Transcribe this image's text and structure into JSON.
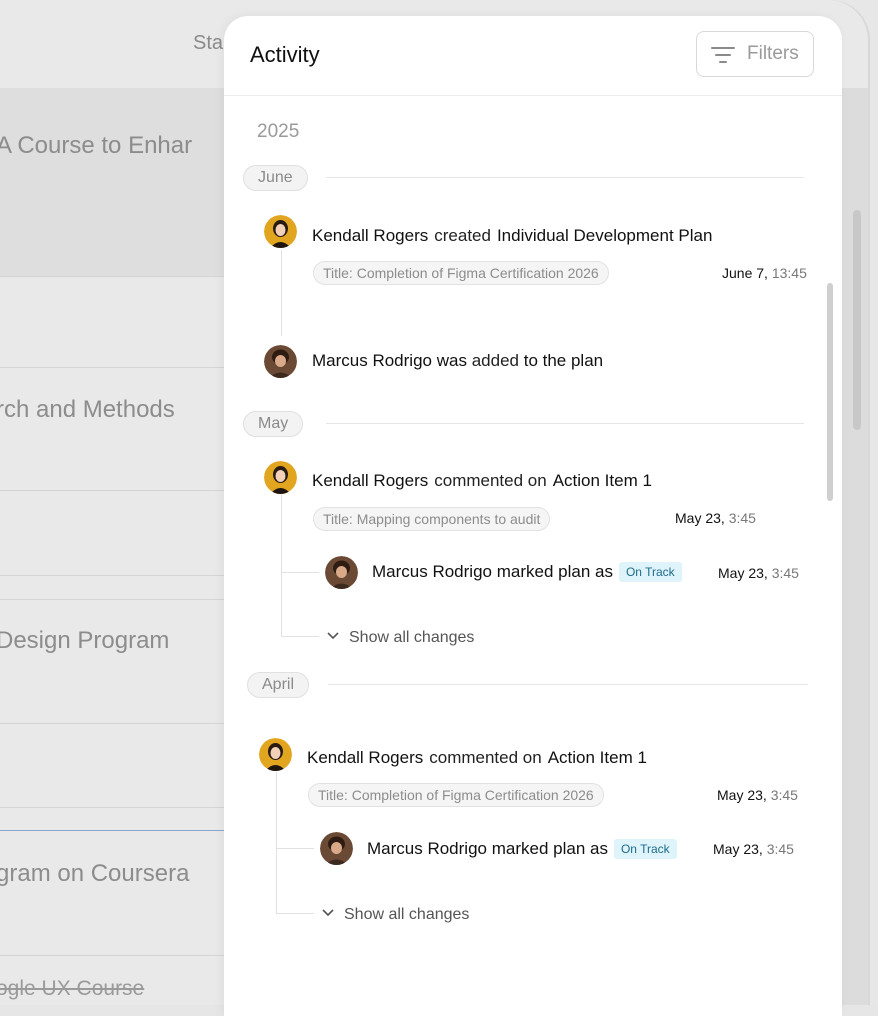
{
  "background": {
    "header_cell": "Sta",
    "rows": [
      {
        "text": "A Course to Enhar",
        "highlight": true
      },
      {
        "text": ""
      },
      {
        "text": "rch and Methods"
      },
      {
        "text": ""
      },
      {
        "text": "Design Program"
      },
      {
        "text": ""
      },
      {
        "text": "gram on Coursera"
      },
      {
        "text": "ogle UX Course",
        "strikethrough": true
      }
    ]
  },
  "panel": {
    "title": "Activity",
    "filters_label": "Filters",
    "filters_icon": "filter-lines-icon",
    "year": "2025",
    "groups": [
      {
        "month": "June",
        "entries": [
          {
            "actor": "Kendall Rogers",
            "verb": "created",
            "object": "Individual Development Plan",
            "chip": "Title: Completion of Figma Certification 2026",
            "date": "June 7,",
            "time": "13:45"
          },
          {
            "actor": "Marcus Rodrigo",
            "text_was": "was",
            "text_added": "added",
            "text_to": "to the plan"
          }
        ]
      },
      {
        "month": "May",
        "entries": [
          {
            "actor": "Kendall Rogers",
            "verb": "commented on",
            "object": "Action Item 1",
            "chip": "Title: Mapping components to audit",
            "date": "May 23,",
            "time": "3:45",
            "sub": {
              "actor": "Marcus Rodrigo",
              "verb": "marked plan as",
              "badge": "On Track",
              "date": "May 23,",
              "time": "3:45"
            },
            "show_all": "Show all changes"
          }
        ]
      },
      {
        "month": "April",
        "entries": [
          {
            "actor": "Kendall Rogers",
            "verb": "commented on",
            "object": "Action Item 1",
            "chip": "Title: Completion of Figma Certification 2026",
            "date": "May 23,",
            "time": "3:45",
            "sub": {
              "actor": "Marcus Rodrigo",
              "verb": "marked plan as",
              "badge": "On Track",
              "date": "May 23,",
              "time": "3:45"
            },
            "show_all": "Show all changes"
          }
        ]
      }
    ]
  },
  "colors": {
    "badge_bg": "#dff3fb",
    "badge_text": "#1d6b8a",
    "kendall_avatar_bg": "#e2a520",
    "marcus_avatar_bg": "#6b4a35"
  }
}
